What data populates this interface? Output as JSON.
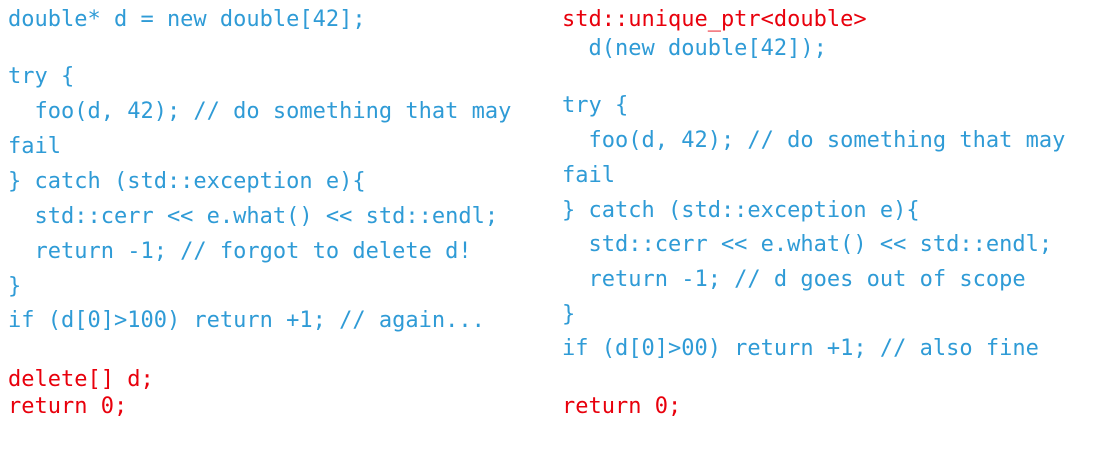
{
  "colors": {
    "code": "#2f9bd6",
    "highlight": "#e8000c"
  },
  "left": {
    "lines": [
      {
        "text": "double* d = new double[42];",
        "color": "blue"
      },
      {
        "text": "try {",
        "color": "blue"
      },
      {
        "text": "  foo(d, 42); // do something that may",
        "color": "blue"
      },
      {
        "text": "fail",
        "color": "blue"
      },
      {
        "text": "} catch (std::exception e){",
        "color": "blue"
      },
      {
        "text": "  std::cerr << e.what() << std::endl;",
        "color": "blue"
      },
      {
        "text": "  return -1; // forgot to delete d!",
        "color": "blue"
      },
      {
        "text": "}",
        "color": "blue"
      },
      {
        "text": "if (d[0]>100) return +1; // again...",
        "color": "blue"
      },
      {
        "text": "delete[] d;",
        "color": "red"
      },
      {
        "text": "return 0;",
        "color": "red"
      }
    ]
  },
  "right": {
    "lines": [
      {
        "text": "std::unique_ptr<double>",
        "color": "red"
      },
      {
        "text": "  d(new double[42]);",
        "color": "blue"
      },
      {
        "text": "try {",
        "color": "blue"
      },
      {
        "text": "  foo(d, 42); // do something that may",
        "color": "blue"
      },
      {
        "text": "fail",
        "color": "blue"
      },
      {
        "text": "} catch (std::exception e){",
        "color": "blue"
      },
      {
        "text": "  std::cerr << e.what() << std::endl;",
        "color": "blue"
      },
      {
        "text": "  return -1; // d goes out of scope",
        "color": "blue"
      },
      {
        "text": "}",
        "color": "blue"
      },
      {
        "text": "if (d[0]>00) return +1; // also fine",
        "color": "blue"
      },
      {
        "text": "return 0;",
        "color": "red"
      }
    ]
  }
}
